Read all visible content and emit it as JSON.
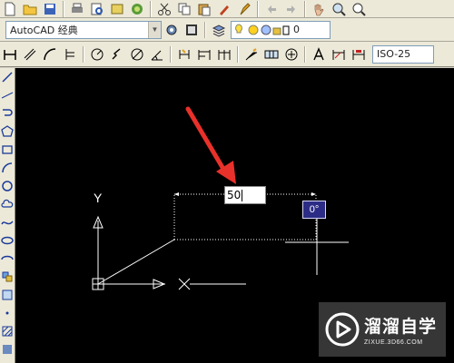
{
  "toolbar_top": {
    "icons": [
      "new-file-icon",
      "open-file-icon",
      "save-icon",
      "print-icon",
      "plot-preview-icon",
      "publish-icon",
      "design-center-icon",
      "cut-icon",
      "copy-icon",
      "paste-icon",
      "match-properties-icon",
      "brush-icon",
      "undo-icon",
      "redo-icon",
      "pan-icon",
      "zoom-realtime-icon",
      "zoom-window-icon"
    ]
  },
  "workspace": {
    "selected": "AutoCAD 经典"
  },
  "layer": {
    "current": "0"
  },
  "dim_toolbar": {
    "style": "ISO-25"
  },
  "drawing": {
    "ucs_y_label": "Y",
    "dynamic_input": {
      "length": "50",
      "angle": "0°"
    }
  },
  "watermark": {
    "title": "溜溜自学",
    "url": "ZIXUE.3D66.COM"
  },
  "colors": {
    "canvas_bg": "#000000",
    "arrow": "#e8312a",
    "angle_tip_bg": "#2c2c86"
  }
}
